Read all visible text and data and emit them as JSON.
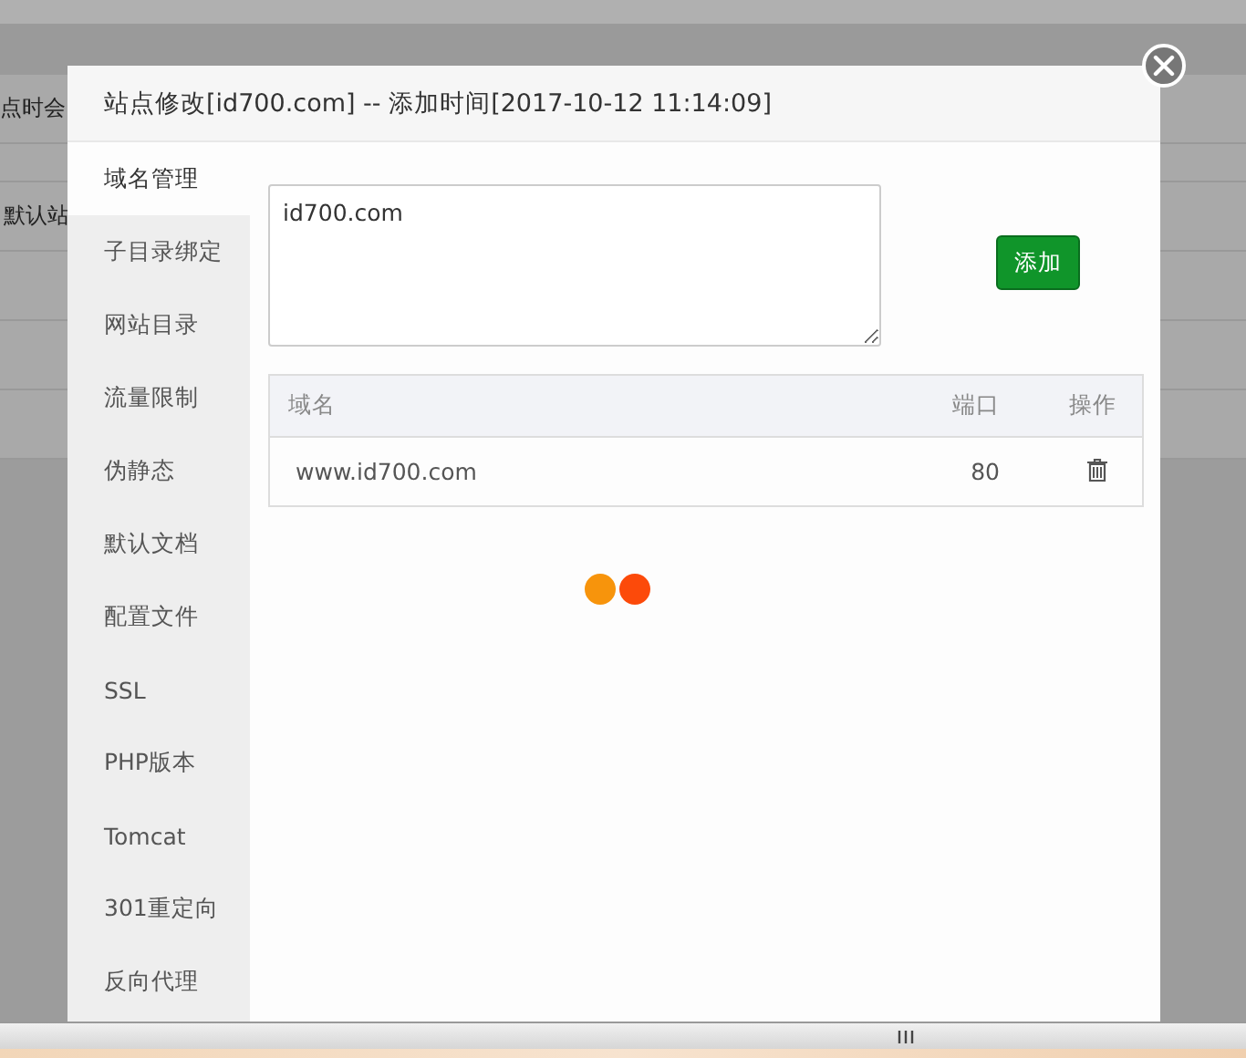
{
  "background_page": {
    "texts": [
      {
        "text": "点时会",
        "kind": "plain"
      },
      {
        "text": "默认站",
        "kind": "plain"
      }
    ]
  },
  "dialog": {
    "title": "站点修改[id700.com] -- 添加时间[2017-10-12 11:14:09]",
    "sidebar": {
      "items": [
        {
          "label": "域名管理",
          "selected": true
        },
        {
          "label": "子目录绑定",
          "selected": false
        },
        {
          "label": "网站目录",
          "selected": false
        },
        {
          "label": "流量限制",
          "selected": false
        },
        {
          "label": "伪静态",
          "selected": false
        },
        {
          "label": "默认文档",
          "selected": false
        },
        {
          "label": "配置文件",
          "selected": false
        },
        {
          "label": "SSL",
          "selected": false
        },
        {
          "label": "PHP版本",
          "selected": false
        },
        {
          "label": "Tomcat",
          "selected": false
        },
        {
          "label": "301重定向",
          "selected": false
        },
        {
          "label": "反向代理",
          "selected": false
        }
      ]
    },
    "domain_input": {
      "value": "id700.com"
    },
    "add_button": "添加",
    "table": {
      "columns": [
        "域名",
        "端口",
        "操作"
      ],
      "rows": [
        {
          "domain": "www.id700.com",
          "port": "80"
        }
      ]
    }
  }
}
